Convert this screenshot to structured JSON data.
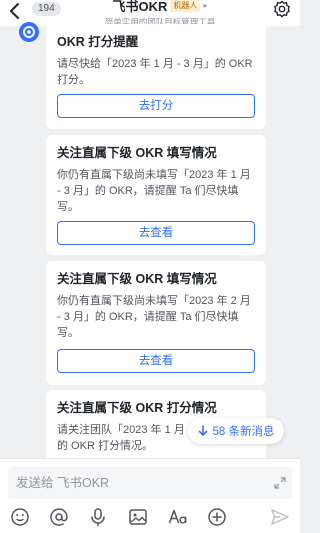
{
  "header": {
    "back_count": "194",
    "title": "飞书OKR",
    "bot_tag": "机器人",
    "title_arrow": "▸",
    "subtitle": "简单实用的团队目标管理工具"
  },
  "cards": [
    {
      "title": "OKR 打分提醒",
      "text": "请尽快给「2023 年 1 月 - 3 月」的 OKR 打分。",
      "button": "去打分"
    },
    {
      "title": "关注直属下级 OKR 填写情况",
      "text": "你仍有直属下级尚未填写「2023 年 1 月 - 3 月」的 OKR，请提醒 Ta 们尽快填写。",
      "button": "去查看"
    },
    {
      "title": "关注直属下级 OKR 填写情况",
      "text": "你仍有直属下级尚未填写「2023 年 2 月 - 3 月」的 OKR，请提醒 Ta 们尽快填写。",
      "button": "去查看"
    },
    {
      "title": "关注直属下级 OKR 打分情况",
      "text": "请关注团队「2023 年 1 月 - 3 月」周期的 OKR 打分情况。"
    }
  ],
  "new_messages": "58 条新消息",
  "input": {
    "placeholder": "发送给 飞书OKR"
  },
  "toolbar_icons": [
    "emoji-icon",
    "mention-icon",
    "microphone-icon",
    "image-icon",
    "text-format-icon",
    "plus-icon",
    "send-icon"
  ],
  "colors": {
    "accent": "#3370ff",
    "background": "#eff0f2",
    "bot_tag_bg": "#fdefd0",
    "bot_tag_text": "#b26a00"
  }
}
